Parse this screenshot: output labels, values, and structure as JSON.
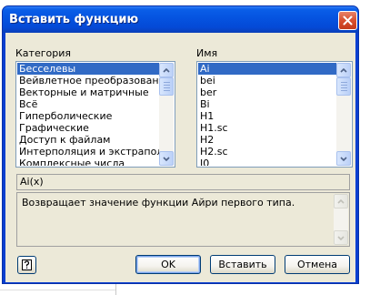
{
  "window": {
    "title": "Вставить функцию"
  },
  "category": {
    "label": "Категория",
    "items": [
      "Бесселевы",
      "Вейвлетное преобразование",
      "Векторные и матричные",
      "Всё",
      "Гиперболические",
      "Графические",
      "Доступ к файлам",
      "Интерполяция и экстраполяц",
      "Комплексные числа"
    ],
    "selected_index": 0
  },
  "name": {
    "label": "Имя",
    "items": [
      "Ai",
      "bei",
      "ber",
      "Bi",
      "H1",
      "H1.sc",
      "H2",
      "H2.sc",
      "I0"
    ],
    "selected_index": 0
  },
  "syntax": "Ai(x)",
  "description": "Возвращает значение функции Айри первого типа.",
  "buttons": {
    "ok": "OK",
    "insert": "Вставить",
    "cancel": "Отмена"
  },
  "icons": {
    "close": "close-icon",
    "help": "help-icon",
    "scroll_up": "chevron-up-icon",
    "scroll_down": "chevron-down-icon"
  },
  "colors": {
    "title_bar": "#0553e0",
    "selection": "#316ac5",
    "dialog_bg": "#ece9d8",
    "close_button": "#d8502f"
  }
}
